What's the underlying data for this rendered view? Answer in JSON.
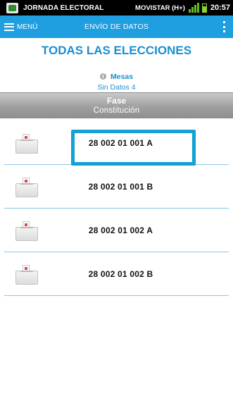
{
  "status_bar": {
    "app_name": "JORNADA ELECTORAL",
    "carrier": "MOVISTAR (H+)",
    "time": "20:57"
  },
  "action_bar": {
    "menu_label": "MENÚ",
    "title": "ENVÍO DE DATOS"
  },
  "heading": "TODAS LAS ELECCIONES",
  "mesas": {
    "label": "Mesas",
    "status": "Sin Datos 4"
  },
  "fase": {
    "label": "Fase",
    "value": "Constitución"
  },
  "mesas_list": [
    {
      "id": "28 002 01 001 A",
      "selected": true
    },
    {
      "id": "28 002 01 001 B",
      "selected": false
    },
    {
      "id": "28 002 01 002 A",
      "selected": false
    },
    {
      "id": "28 002 01 002 B",
      "selected": false
    }
  ],
  "colors": {
    "accent": "#1f9ee0",
    "heading": "#1a8fd0",
    "focus": "#13a1d6",
    "divider": "#8cc6e6"
  },
  "icons": {
    "menu": "hamburger-icon",
    "overflow": "more-vert-icon",
    "info": "info-icon",
    "row": "ballot-box-icon"
  }
}
